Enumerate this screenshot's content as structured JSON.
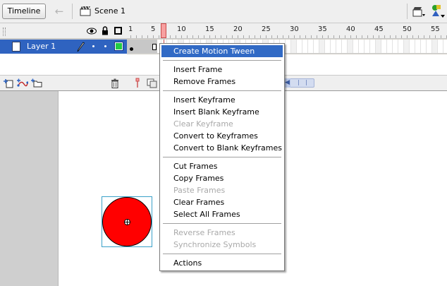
{
  "toolbar": {
    "timeline_label": "Timeline",
    "scene_label": "Scene 1",
    "icons": [
      "back-arrow-icon",
      "scene-icon",
      "edit-scene-icon",
      "edit-symbol-icon"
    ]
  },
  "timeline": {
    "ruler_labels": [
      "1",
      "5",
      "10",
      "15",
      "20",
      "25",
      "30",
      "35",
      "40",
      "45",
      "50",
      "55"
    ],
    "current_frame": 7,
    "layers": [
      {
        "name": "Layer 1",
        "color": "#22cc44",
        "selected": true
      }
    ],
    "header_icons": [
      "eye-icon",
      "lock-icon",
      "outline-icon"
    ],
    "bottom_icons": [
      "add-layer-icon",
      "add-guide-layer-icon",
      "insert-folder-icon",
      "trash-icon",
      "center-frame-icon",
      "onion-skin-icon"
    ]
  },
  "stage": {
    "shape_fill": "#ff0000"
  },
  "context_menu": {
    "items": [
      {
        "label": "Create Motion Tween",
        "highlighted": true
      },
      {
        "separator": true
      },
      {
        "label": "Insert Frame"
      },
      {
        "label": "Remove Frames"
      },
      {
        "separator": true
      },
      {
        "label": "Insert Keyframe"
      },
      {
        "label": "Insert Blank Keyframe"
      },
      {
        "label": "Clear Keyframe",
        "disabled": true
      },
      {
        "label": "Convert to Keyframes"
      },
      {
        "label": "Convert to Blank Keyframes"
      },
      {
        "separator": true
      },
      {
        "label": "Cut Frames"
      },
      {
        "label": "Copy Frames"
      },
      {
        "label": "Paste Frames",
        "disabled": true
      },
      {
        "label": "Clear Frames"
      },
      {
        "label": "Select All Frames"
      },
      {
        "separator": true
      },
      {
        "label": "Reverse Frames",
        "disabled": true
      },
      {
        "label": "Synchronize Symbols",
        "disabled": true
      },
      {
        "separator": true
      },
      {
        "label": "Actions"
      }
    ]
  }
}
